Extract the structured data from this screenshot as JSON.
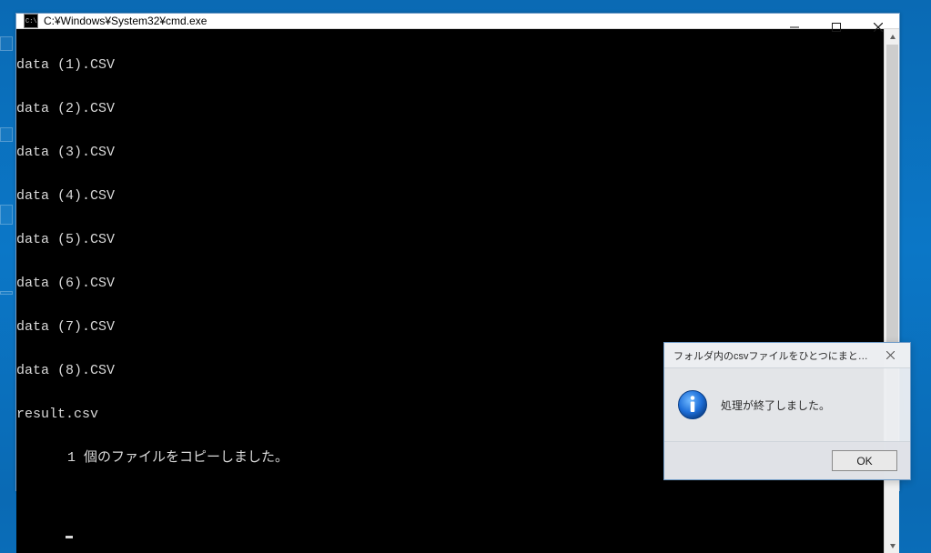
{
  "cmd_window": {
    "title": "C:¥Windows¥System32¥cmd.exe",
    "lines": [
      "data (1).CSV",
      "data (2).CSV",
      "data (3).CSV",
      "data (4).CSV",
      "data (5).CSV",
      "data (6).CSV",
      "data (7).CSV",
      "data (8).CSV",
      "result.csv"
    ],
    "status_line": "1 個のファイルをコピーしました。"
  },
  "dialog": {
    "title": "フォルダ内のcsvファイルをひとつにまとめる_cmd.vbs",
    "message": "処理が終了しました。",
    "ok_label": "OK"
  }
}
